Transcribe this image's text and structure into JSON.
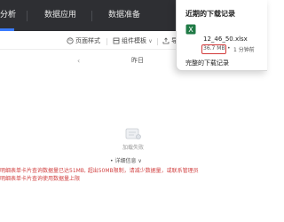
{
  "topbar": {
    "tabs": [
      {
        "label": "分析",
        "active": true
      },
      {
        "label": "数据应用",
        "active": false
      },
      {
        "label": "数据准备",
        "active": false
      }
    ]
  },
  "toolbar": {
    "page_style": "页面样式",
    "component_template": "组件模板",
    "export": "导出"
  },
  "date_filter": {
    "yesterday": "昨日",
    "more": "..."
  },
  "empty_state": {
    "text": "加载失败",
    "detail_link": "• 详细信息 ∨",
    "error_line1": "明细表单卡片查询数据量已达51MB, 超出50MB限制，请减少数据量，或联系管理员",
    "error_line2": "明细表单卡片查询使用数据量上限"
  },
  "download_popup": {
    "title": "近期的下载记录",
    "file_name": "12_46_50.xlsx",
    "file_size": "36.7 MB",
    "separator": "•",
    "file_time": "1 分钟前",
    "all_downloads": "完整的下载记录"
  },
  "colors": {
    "topbar_bg": "#2e2f33",
    "accent": "#3b7cff",
    "error": "#d24343",
    "excel_green": "#1f7a45"
  }
}
